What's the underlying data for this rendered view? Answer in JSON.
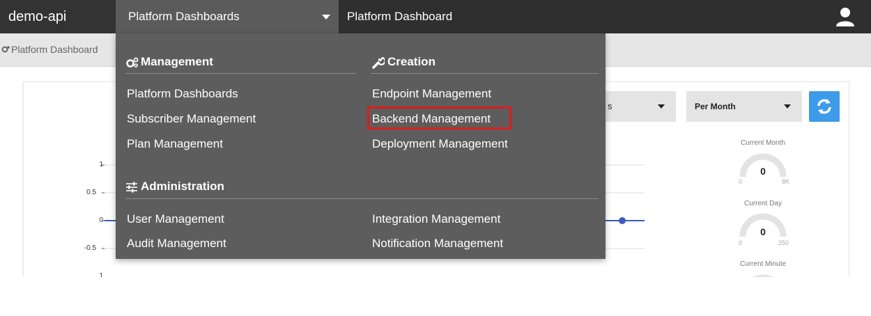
{
  "app": {
    "name": "demo-api"
  },
  "header": {
    "dashboard_select": "Platform Dashboards",
    "page_name": "Platform Dashboard",
    "user_icon": "user-icon"
  },
  "breadcrumb": {
    "label": "Platform Dashboard",
    "icon": "cogs-icon"
  },
  "menu": {
    "management": {
      "heading": "Management",
      "icon": "cogs-icon",
      "items": [
        "Platform Dashboards",
        "Subscriber Management",
        "Plan Management"
      ]
    },
    "creation": {
      "heading": "Creation",
      "icon": "wrench-icon",
      "items": [
        "Endpoint Management",
        "Backend Management",
        "Deployment Management"
      ]
    },
    "administration": {
      "heading": "Administration",
      "icon": "sliders-icon",
      "items": [
        "User Management",
        "Audit Management",
        "Integration Management",
        "Notification Management"
      ]
    },
    "highlighted_item": "Backend Management",
    "highlight_color": "#e01b1b"
  },
  "controls": {
    "range_select_visible": "s",
    "period_select": "Per Month",
    "refresh_icon": "refresh-icon",
    "accent": "#3d9be9"
  },
  "chart": {
    "y_ticks": [
      "1",
      "0.5",
      "0",
      "-0.5",
      "1"
    ],
    "series_color": "#3b5bbd"
  },
  "gauges": [
    {
      "title": "Current Month",
      "value": "0",
      "min": "0",
      "max": "8K"
    },
    {
      "title": "Current Day",
      "value": "0",
      "min": "0",
      "max": "250"
    },
    {
      "title": "Current Minute"
    }
  ]
}
